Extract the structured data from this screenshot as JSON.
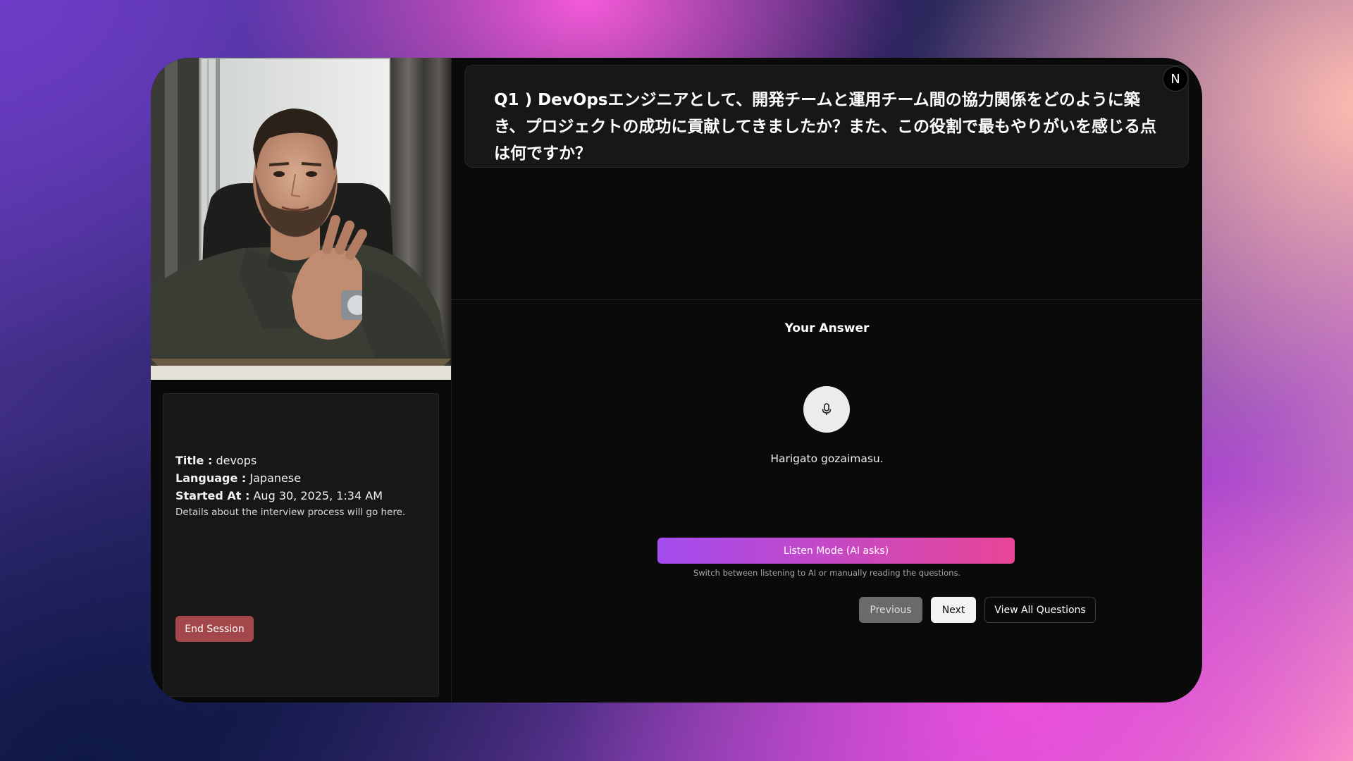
{
  "question": {
    "text": "Q1 ) DevOpsエンジニアとして、開発チームと運用チーム間の協力関係をどのように築き、プロジェクトの成功に貢献してきましたか？また、この役割で最もやりがいを感じる点は何ですか？"
  },
  "badge": {
    "letter": "N"
  },
  "session": {
    "title_label": "Title :",
    "title_value": "devops",
    "language_label": "Language :",
    "language_value": "Japanese",
    "started_label": "Started At :",
    "started_value": "Aug 30, 2025, 1:34 AM",
    "details": "Details about the interview process will go here.",
    "end_button": "End Session"
  },
  "answer": {
    "title": "Your Answer",
    "transcript": "Harigato gozaimasu.",
    "mic_icon": "microphone-icon"
  },
  "mode": {
    "listen_button": "Listen Mode (AI asks)",
    "hint": "Switch between listening to AI or manually reading the questions."
  },
  "navigation": {
    "previous": "Previous",
    "next": "Next",
    "view_all": "View All Questions"
  },
  "colors": {
    "end_button": "#a3474a",
    "listen_gradient_start": "#a34cf0",
    "listen_gradient_end": "#e84596",
    "panel": "#171717",
    "background": "#0a0a0a"
  }
}
